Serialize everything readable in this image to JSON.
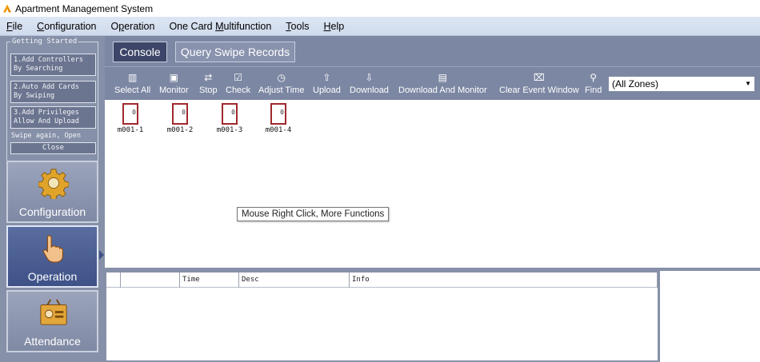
{
  "window": {
    "title": "Apartment Management System"
  },
  "menu": [
    {
      "pre": "",
      "u": "F",
      "post": "ile"
    },
    {
      "pre": "",
      "u": "C",
      "post": "onfiguration"
    },
    {
      "pre": "O",
      "u": "p",
      "post": "eration"
    },
    {
      "pre": "One Card ",
      "u": "M",
      "post": "ultifunction"
    },
    {
      "pre": "",
      "u": "T",
      "post": "ools"
    },
    {
      "pre": "",
      "u": "H",
      "post": "elp"
    }
  ],
  "sidebar": {
    "getting_started": {
      "title": "Getting Started",
      "steps": [
        {
          "line1": "1.Add Controllers",
          "line2": "By Searching"
        },
        {
          "line1": "2.Auto Add Cards",
          "line2": "By Swiping"
        },
        {
          "line1": "3.Add Privileges",
          "line2": "Allow And Upload"
        }
      ],
      "note": "Swipe again, Open",
      "close": "Close"
    },
    "nav": [
      {
        "label": "Configuration",
        "icon": "gear-icon"
      },
      {
        "label": "Operation",
        "icon": "hand-pointer-icon"
      },
      {
        "label": "Attendance",
        "icon": "id-card-icon"
      }
    ],
    "active": "Operation"
  },
  "tabs": {
    "console": "Console",
    "query": "Query Swipe Records"
  },
  "toolbar": {
    "buttons": [
      {
        "label": "Select All",
        "icon": "select-all-icon"
      },
      {
        "label": "Monitor",
        "icon": "monitor-icon"
      },
      {
        "label": "Stop",
        "icon": "stop-icon"
      },
      {
        "label": "Check",
        "icon": "check-icon"
      },
      {
        "label": "Adjust Time",
        "icon": "clock-icon"
      },
      {
        "label": "Upload",
        "icon": "upload-icon"
      },
      {
        "label": "Download",
        "icon": "download-icon"
      },
      {
        "label": "Download And Monitor",
        "icon": "download-monitor-icon"
      },
      {
        "label": "Clear Event Window",
        "icon": "clear-icon"
      },
      {
        "label": "Find",
        "icon": "search-icon"
      }
    ],
    "zone_select": "(All Zones)"
  },
  "doors": [
    {
      "name": "m001-1",
      "value": "0"
    },
    {
      "name": "m001-2",
      "value": "0"
    },
    {
      "name": "m001-3",
      "value": "0"
    },
    {
      "name": "m001-4",
      "value": "0"
    }
  ],
  "tooltip": "Mouse Right Click, More Functions",
  "event_grid": {
    "columns": [
      "",
      "",
      "Time",
      "Desc",
      "Info"
    ]
  }
}
